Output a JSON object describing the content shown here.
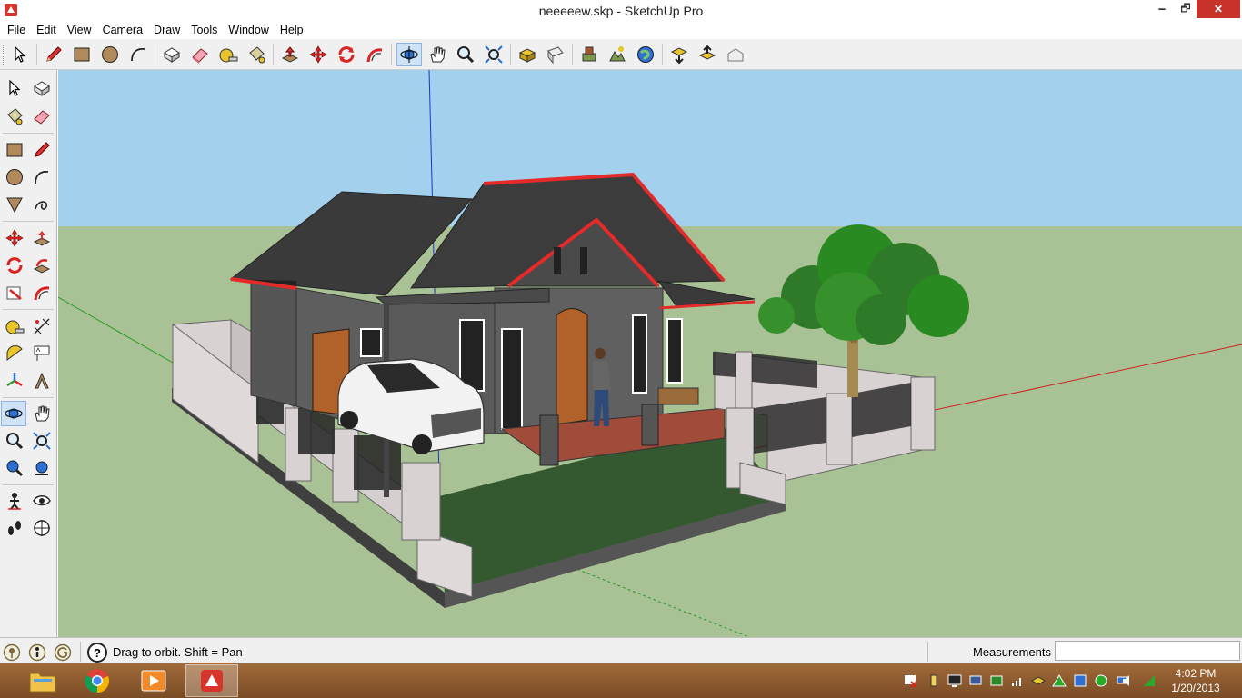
{
  "window": {
    "title": "neeeeew.skp - SketchUp Pro",
    "minimize_glyph": "🗕",
    "maximize_glyph": "🗗",
    "close_glyph": "✕"
  },
  "menu": [
    "File",
    "Edit",
    "View",
    "Camera",
    "Draw",
    "Tools",
    "Window",
    "Help"
  ],
  "toolbar": {
    "tools": [
      "select-icon",
      "pencil-icon",
      "rectangle-icon",
      "circle-icon",
      "arc-icon",
      "make-component-icon",
      "eraser-icon",
      "tape-measure-icon",
      "paint-bucket-icon",
      "push-pull-icon",
      "move-icon",
      "rotate-icon",
      "follow-me-icon",
      "orbit-icon",
      "pan-icon",
      "zoom-icon",
      "zoom-extents-icon",
      "get-models-icon",
      "share-model-icon",
      "share-component-icon",
      "add-location-icon",
      "toggle-terrain-icon",
      "preview-google-earth-icon",
      "get-photo-texture-icon",
      "extension-warehouse-icon"
    ],
    "active_tool": "orbit-icon"
  },
  "palette": {
    "active_tool": "orbit"
  },
  "status": {
    "hint": "Drag to orbit.  Shift = Pan",
    "measurements_label": "Measurements",
    "measurements_value": ""
  },
  "taskbar": {
    "apps": [
      "file-explorer-icon",
      "chrome-icon",
      "media-player-icon",
      "sketchup-icon"
    ],
    "active_app": "sketchup-icon",
    "time": "4:02 PM",
    "date": "1/20/2013"
  },
  "colors": {
    "sky": "#a3d0ec",
    "ground": "#a9c295",
    "roof_trim": "#e52a2a",
    "wall": "#5b5b5b",
    "close_button": "#c7332a",
    "taskbar": "#8c5a2e"
  }
}
